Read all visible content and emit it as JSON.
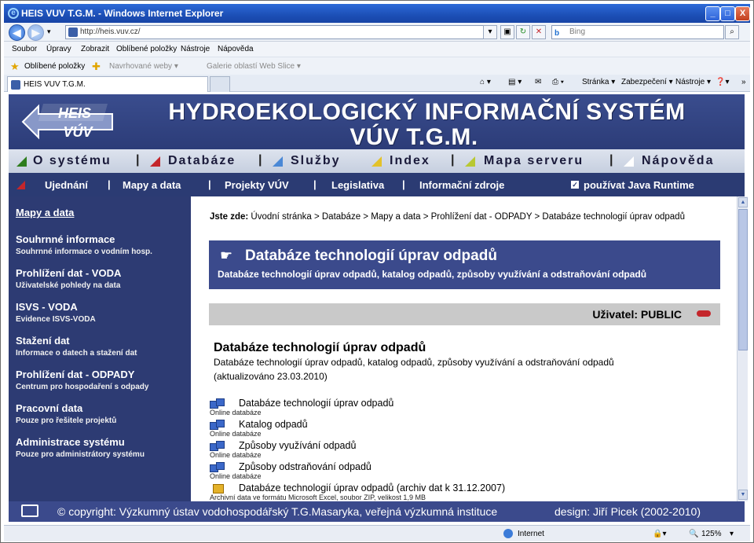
{
  "window": {
    "title": "HEIS VUV T.G.M. - Windows Internet Explorer",
    "minimize": "_",
    "maximize": "□",
    "close": "X"
  },
  "address_bar": {
    "url": "http://heis.vuv.cz/",
    "search_placeholder": "Bing",
    "search_brand": "b"
  },
  "menu": {
    "items": [
      "Soubor",
      "Úpravy",
      "Zobrazit",
      "Oblíbené položky",
      "Nástroje",
      "Nápověda"
    ]
  },
  "favorites_bar": {
    "favorites": "Oblíbené položky",
    "suggested_sites": "Navrhované weby ▾",
    "web_slice_gallery": "Galerie oblastí Web Slice ▾"
  },
  "tab": {
    "label": "HEIS VUV T.G.M."
  },
  "command_bar": {
    "page": "Stránka ▾",
    "safety": "Zabezpečení ▾",
    "tools": "Nástroje ▾",
    "more": "»"
  },
  "banner": {
    "logo_top": "HEIS",
    "logo_bottom": "VÚV",
    "title_line1": "HYDROEKOLOGICKÝ INFORMAČNÍ SYSTÉM",
    "title_line2": "VÚV T.G.M."
  },
  "nav_primary": {
    "items": [
      "O systému",
      "Databáze",
      "Služby",
      "Index",
      "Mapa serveru",
      "Nápověda"
    ],
    "colors": [
      "#2e7d1e",
      "#c4262b",
      "#4a88d6",
      "#e3c22a",
      "#b8c832",
      "#ffffff"
    ]
  },
  "nav_secondary": {
    "items": [
      "Ujednání",
      "Mapy a data",
      "Projekty VÚV",
      "Legislativa",
      "Informační zdroje"
    ],
    "java_label": "používat Java Runtime",
    "java_checked": true
  },
  "sidebar": {
    "top_link": "Mapy a data",
    "sections": [
      {
        "title": "Souhrnné informace",
        "subtitle": "Souhrnné informace o vodním hosp."
      },
      {
        "title": "Prohlížení dat - VODA",
        "subtitle": "Uživatelské pohledy na data"
      },
      {
        "title": "ISVS - VODA",
        "subtitle": "Evidence ISVS-VODA"
      },
      {
        "title": "Stažení dat",
        "subtitle": "Informace o datech a stažení dat"
      },
      {
        "title": "Prohlížení dat - ODPADY",
        "subtitle": "Centrum pro hospodaření s odpady"
      },
      {
        "title": "Pracovní data",
        "subtitle": "Pouze pro řešitele projektů"
      },
      {
        "title": "Administrace systému",
        "subtitle": "Pouze pro administrátory systému"
      }
    ]
  },
  "content": {
    "breadcrumb_label": "Jste zde:",
    "breadcrumb": "Úvodní stránka > Databáze > Mapy a data > Prohlížení dat - ODPADY > Databáze technologií úprav odpadů",
    "header_title": "Databáze technologií úprav odpadů",
    "header_subtitle": "Databáze technologií úprav odpadů, katalog odpadů, způsoby využívání a odstraňování odpadů",
    "user_label": "Uživatel: PUBLIC",
    "title": "Databáze technologií úprav odpadů",
    "description": "Databáze technologií úprav odpadů, katalog odpadů, způsoby využívání a odstraňování odpadů",
    "updated": "(aktualizováno 23.03.2010)",
    "links": [
      {
        "label": "Databáze technologií úprav odpadů",
        "sub": "Online databáze"
      },
      {
        "label": "Katalog odpadů",
        "sub": "Online databáze"
      },
      {
        "label": "Způsoby využívání odpadů",
        "sub": "Online databáze"
      },
      {
        "label": "Způsoby odstraňování odpadů",
        "sub": "Online databáze"
      },
      {
        "label": "Databáze technologií úprav odpadů (archiv dat k 31.12.2007)",
        "sub": "Archivní data ve formátu Microsoft Excel, soubor ZIP, velikost 1,9 MB"
      }
    ]
  },
  "footer": {
    "copyright": "© copyright: Výzkumný ústav vodohospodářský T.G.Masaryka, veřejná výzkumná instituce",
    "design": "design: Jiří Picek (2002-2010)"
  },
  "statusbar": {
    "zone": "Internet",
    "zoom": "125%"
  }
}
